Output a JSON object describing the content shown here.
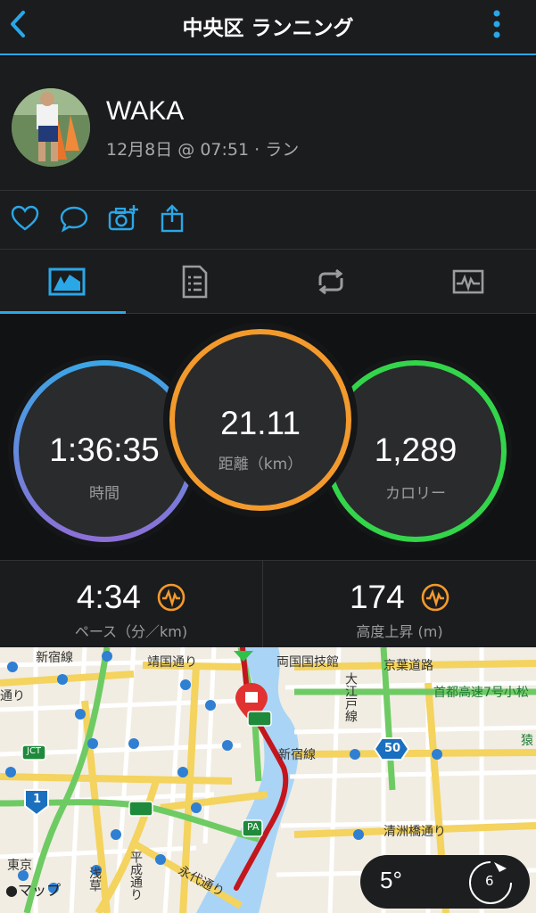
{
  "header": {
    "title": "中央区 ランニング"
  },
  "profile": {
    "name": "WAKA",
    "meta": "12月8日 @ 07:51 · ラン"
  },
  "actions": [
    "like-icon",
    "comment-icon",
    "add-photo-icon",
    "share-icon"
  ],
  "tabs": [
    "tab-overview",
    "tab-details",
    "tab-laps",
    "tab-charts"
  ],
  "rings": {
    "time": {
      "value": "1:36:35",
      "label": "時間",
      "color": "#6b6fe0"
    },
    "distance": {
      "value": "21.11",
      "label": "距離（km）",
      "color": "#f39a2c"
    },
    "calories": {
      "value": "1,289",
      "label": "カロリー",
      "color": "#33d54a"
    }
  },
  "stats": {
    "pace": {
      "value": "4:34",
      "label": "ペース（分／km)"
    },
    "elevation": {
      "value": "174",
      "label": "高度上昇 (m)"
    }
  },
  "map": {
    "labels": {
      "shinjuku1": "新宿線",
      "yasukuni": "靖国通り",
      "ryogoku": "両国国技館",
      "keiyo": "京葉道路",
      "shuto7": "首都高速7号小松",
      "oedo": "大江戸線",
      "shinjuku2": "新宿線",
      "kiyosu": "清洲橋通り",
      "heisei": "平成通り",
      "eitai": "永代通り",
      "asakusa": "浅草",
      "tokyo": "東京",
      "sarue": "猿",
      "dori": "通り",
      "jct": "JCT",
      "pa": "PA",
      "route50": "50",
      "route1": "1"
    },
    "attribution": "マップ"
  },
  "weather": {
    "temp": "5°",
    "wind": "6"
  }
}
